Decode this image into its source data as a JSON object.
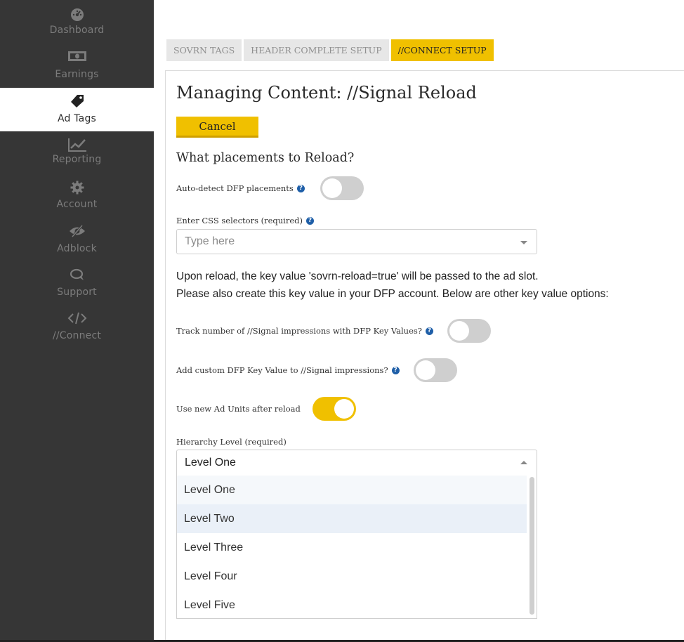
{
  "sidebar": {
    "items": [
      {
        "label": "Dashboard",
        "icon": "dashboard-gauge-icon"
      },
      {
        "label": "Earnings",
        "icon": "money-bill-icon"
      },
      {
        "label": "Ad Tags",
        "icon": "tag-icon"
      },
      {
        "label": "Reporting",
        "icon": "line-chart-icon"
      },
      {
        "label": "Account",
        "icon": "gear-icon"
      },
      {
        "label": "Adblock",
        "icon": "eye-slash-icon"
      },
      {
        "label": "Support",
        "icon": "chat-bubble-icon"
      },
      {
        "label": "//Connect",
        "icon": "code-brackets-icon"
      }
    ],
    "active": "Ad Tags"
  },
  "tabs": [
    {
      "label": "SOVRN TAGS",
      "active": false
    },
    {
      "label": "HEADER COMPLETE SETUP",
      "active": false
    },
    {
      "label": "//CONNECT SETUP",
      "active": true
    }
  ],
  "main": {
    "title": "Managing Content: //Signal Reload",
    "cancel_label": "Cancel",
    "section_heading": "What placements to Reload?",
    "auto_detect_label": "Auto-detect DFP placements",
    "auto_detect_on": false,
    "css_selectors_label": "Enter CSS selectors (required)",
    "css_selectors_placeholder": "Type here",
    "info_line1": "Upon reload, the key value 'sovrn-reload=true' will be passed to the ad slot.",
    "info_line2": "Please also create this key value in your DFP account. Below are other key value options:",
    "track_label": "Track number of //Signal impressions with DFP Key Values?",
    "track_on": false,
    "custom_kv_label": "Add custom DFP Key Value to //Signal impressions?",
    "custom_kv_on": false,
    "new_ad_units_label": "Use new Ad Units after reload",
    "new_ad_units_on": true,
    "hierarchy_label": "Hierarchy Level (required)",
    "hierarchy_value": "Level One",
    "hierarchy_options": [
      "Level One",
      "Level Two",
      "Level Three",
      "Level Four",
      "Level Five"
    ]
  },
  "help_glyph": "?",
  "colors": {
    "accent": "#f0c000",
    "sidebar_bg": "#363636",
    "help_blue": "#1f5fa8"
  }
}
